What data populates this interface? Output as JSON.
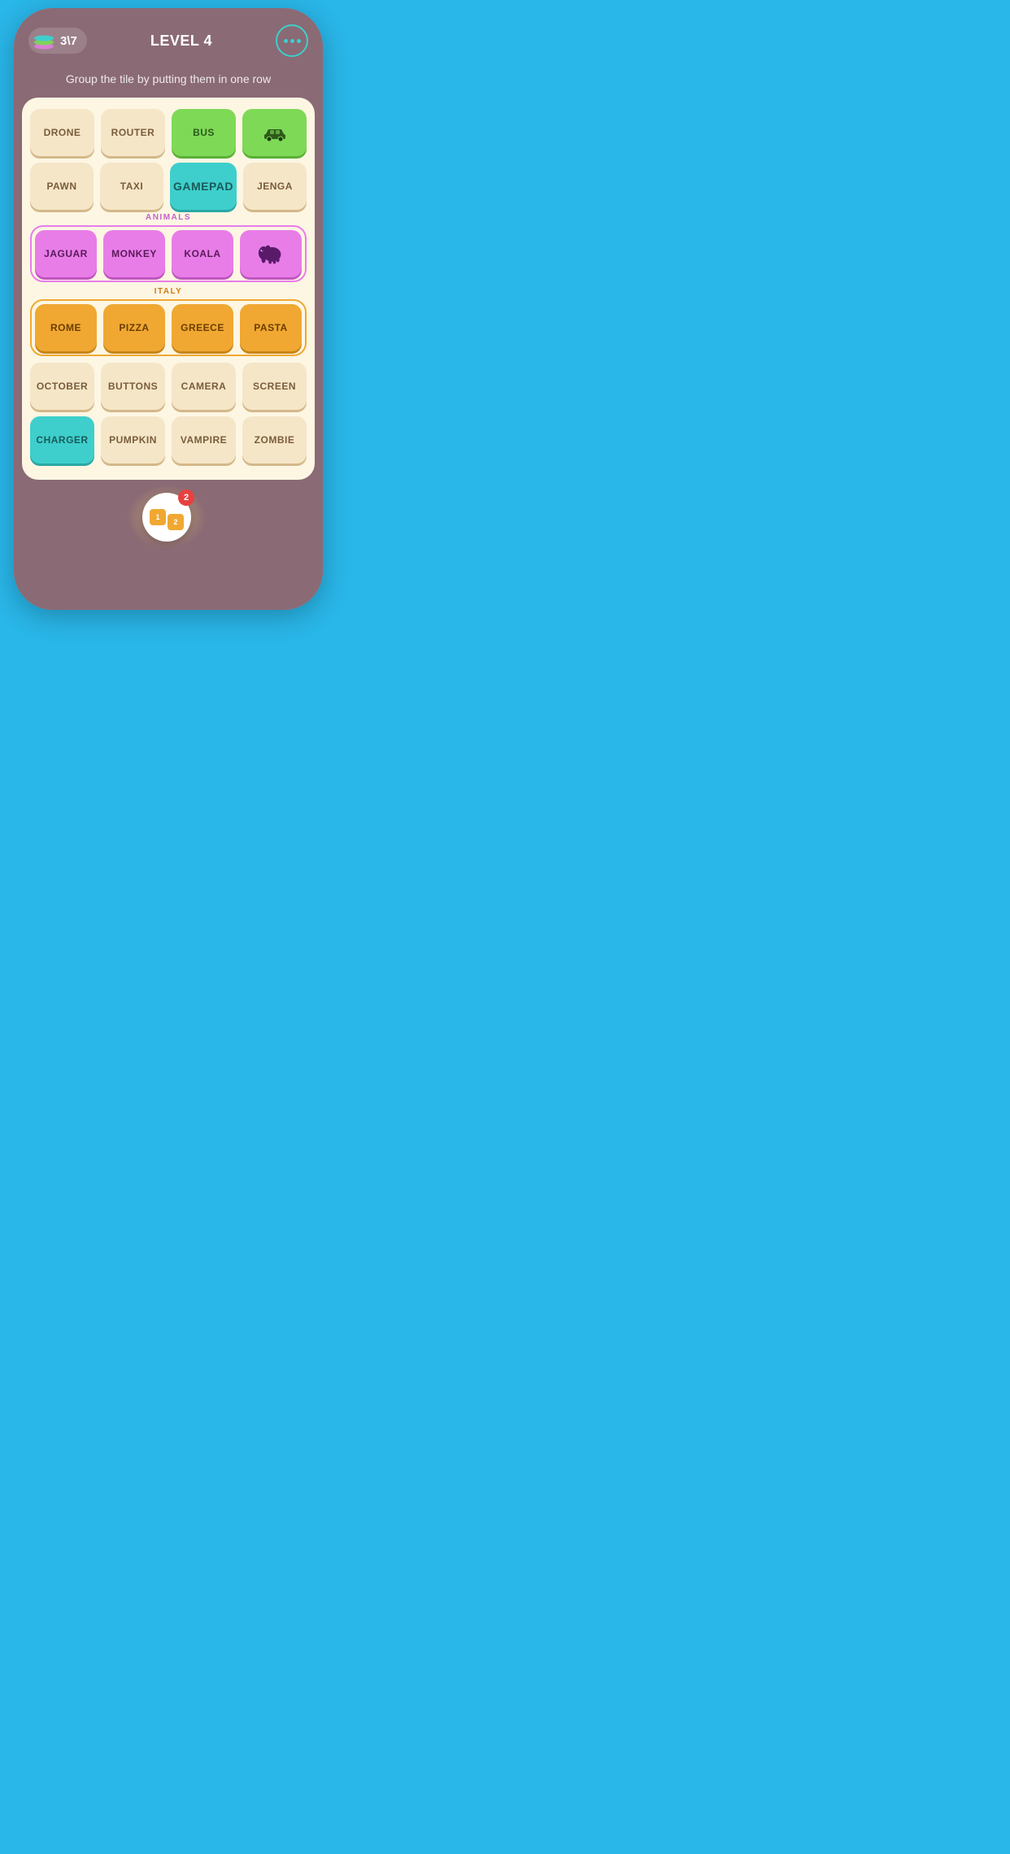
{
  "header": {
    "score": "3\\7",
    "level": "LEVEL 4",
    "menu_label": "menu"
  },
  "subtitle": "Group the tile by putting them in one row",
  "tiles": {
    "row1": [
      {
        "label": "DRONE",
        "type": "beige"
      },
      {
        "label": "ROUTER",
        "type": "beige"
      },
      {
        "label": "BUS",
        "type": "green"
      },
      {
        "label": "🚗",
        "type": "green",
        "is_icon": true
      }
    ],
    "row2": [
      {
        "label": "PAWN",
        "type": "beige"
      },
      {
        "label": "TAXI",
        "type": "beige"
      },
      {
        "label": "GAMEPAD",
        "type": "teal"
      },
      {
        "label": "JENGA",
        "type": "beige"
      }
    ],
    "animals_label": "ANIMALS",
    "animals": [
      {
        "label": "JAGUAR",
        "type": "pink"
      },
      {
        "label": "MONKEY",
        "type": "pink"
      },
      {
        "label": "KOALA",
        "type": "pink"
      },
      {
        "label": "🐘",
        "type": "pink",
        "is_icon": true
      }
    ],
    "italy_label": "ITALY",
    "italy": [
      {
        "label": "ROME",
        "type": "orange"
      },
      {
        "label": "PIZZA",
        "type": "orange"
      },
      {
        "label": "GREECE",
        "type": "orange"
      },
      {
        "label": "PASTA",
        "type": "orange"
      }
    ],
    "row5": [
      {
        "label": "OCTOBER",
        "type": "beige"
      },
      {
        "label": "BUTTONS",
        "type": "beige"
      },
      {
        "label": "CAMERA",
        "type": "beige"
      },
      {
        "label": "SCREEN",
        "type": "beige"
      }
    ],
    "row6": [
      {
        "label": "CHARGER",
        "type": "turquoise"
      },
      {
        "label": "PUMPKIN",
        "type": "beige"
      },
      {
        "label": "VAMPIRE",
        "type": "beige"
      },
      {
        "label": "ZOMBIE",
        "type": "beige"
      }
    ]
  },
  "hint": {
    "count": "2",
    "tile1": "1",
    "tile2": "2"
  }
}
